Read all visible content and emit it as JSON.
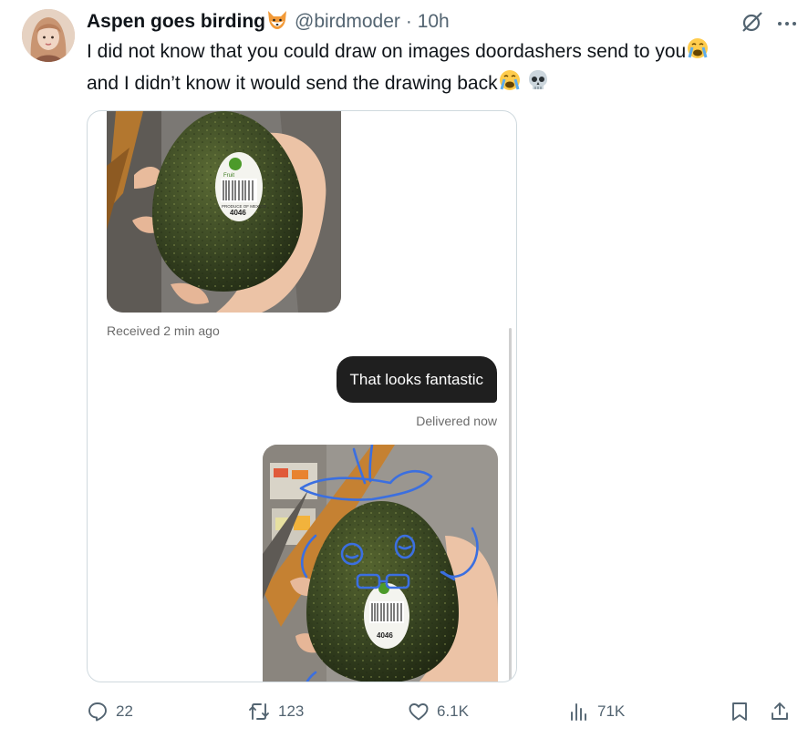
{
  "tweet": {
    "author_name": "Aspen goes birding",
    "handle": "@birdmoder",
    "time": "· 10h",
    "text_line1": "I did not know that you could draw on images doordashers send to you",
    "text_line2": "and I didn’t know it would send the drawing back",
    "name_emoji": "fox-face-icon",
    "text_emojis": [
      "crying-face-icon",
      "crying-face-icon",
      "skull-icon"
    ]
  },
  "conversation": {
    "received_label": "Received 2 min ago",
    "message": "That looks fantastic",
    "delivered_label": "Delivered now",
    "sticker_brand": "Fruit",
    "sticker_code": "4046",
    "sticker_small": "PRODUCE OF MEXICO"
  },
  "actions": {
    "replies": "22",
    "reposts": "123",
    "likes": "6.1K",
    "views": "71K"
  },
  "colors": {
    "text": "#0f1419",
    "secondary": "#536471",
    "border": "#cfd9de",
    "bubble": "#1f1f1f",
    "drawing": "#3b6fe0"
  }
}
